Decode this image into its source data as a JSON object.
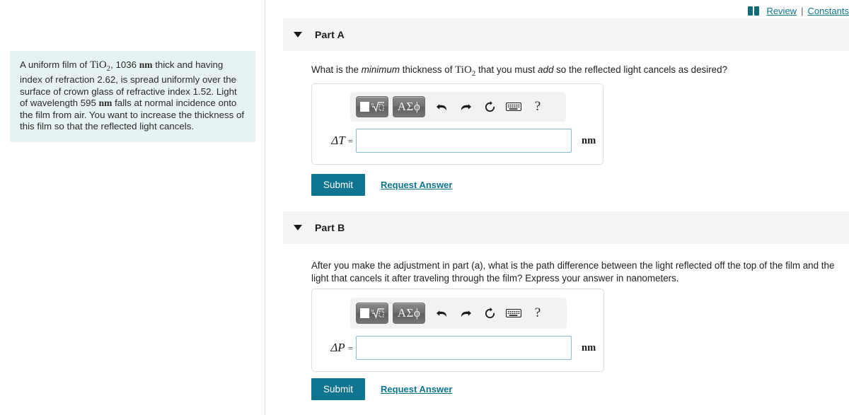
{
  "header": {
    "book_icon": "book-icon",
    "review_label": "Review",
    "separator": "|",
    "constants_label": "Constants"
  },
  "problem": {
    "line1_pre": "A uniform film of ",
    "formula1": "TiO",
    "formula1_sub": "2",
    "line1_mid": ", 1036 ",
    "unit1": "nm",
    "line1_post": " thick and having index of refraction 2.62, is spread uniformly over the surface of crown glass of refractive index 1.52. Light of wavelength 595 ",
    "unit2": "nm",
    "line1_end": " falls at normal incidence onto the film from air. You want to increase the thickness of this film so that the reflected light cancels."
  },
  "toolbar_icons": {
    "template_label": "template-button",
    "greek_label": "ΑΣϕ",
    "undo_label": "undo-icon",
    "redo_label": "redo-icon",
    "reset_label": "reset-icon",
    "keyboard_label": "keyboard-icon",
    "help_label": "?"
  },
  "parts": [
    {
      "id": "a",
      "title": "Part A",
      "caret": "caret-down-icon",
      "question_pre": "What is the ",
      "question_em1": "minimum",
      "question_mid1": " thickness of ",
      "question_formula": "TiO",
      "question_formula_sub": "2",
      "question_mid2": " that you must ",
      "question_em2": "add",
      "question_post": " so the reflected light cancels as desired?",
      "field_symbol": "ΔT",
      "field_equals": "=",
      "field_value": "",
      "field_placeholder": "",
      "field_unit": "nm",
      "submit_label": "Submit",
      "request_label": "Request Answer"
    },
    {
      "id": "b",
      "title": "Part B",
      "caret": "caret-down-icon",
      "question_full": "After you make the adjustment in part (a), what is the path difference between the light reflected off the top of the film and the light that cancels it after traveling through the film? Express your answer in nanometers.",
      "field_symbol": "ΔP",
      "field_equals": "=",
      "field_value": "",
      "field_placeholder": "",
      "field_unit": "nm",
      "submit_label": "Submit",
      "request_label": "Request Answer"
    }
  ],
  "colors": {
    "accent_teal": "#0e7490",
    "problem_panel_bg": "#e7f3f2",
    "band_gray": "#f5f5f5",
    "input_border": "#86bcc9"
  }
}
